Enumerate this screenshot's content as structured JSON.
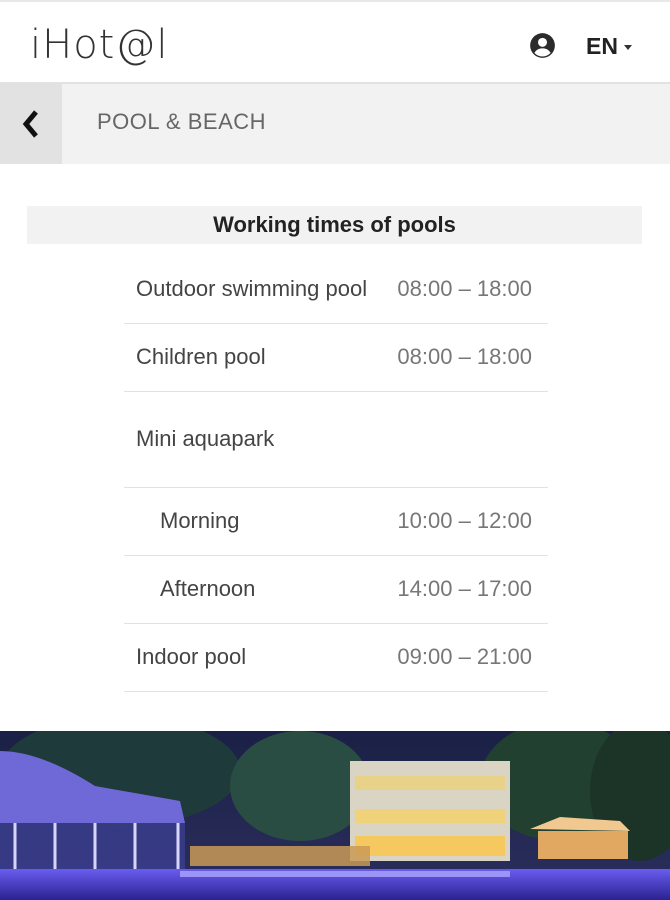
{
  "header": {
    "logo_text": "iHot@l",
    "language": "EN"
  },
  "subbar": {
    "title": "POOL & BEACH"
  },
  "section": {
    "title": "Working times of pools"
  },
  "schedule": [
    {
      "name": "Outdoor swimming pool",
      "time": "08:00 – 18:00"
    },
    {
      "name": "Children pool",
      "time": "08:00 – 18:00"
    },
    {
      "name": "Mini aquapark",
      "time": ""
    },
    {
      "name": "Morning",
      "time": "10:00 – 12:00"
    },
    {
      "name": "Afternoon",
      "time": "14:00 – 17:00"
    },
    {
      "name": "Indoor pool",
      "time": "09:00 – 21:00"
    }
  ],
  "colors": {
    "subbar_bg": "#f2f2f2",
    "back_bg": "#e2e2e2",
    "night_sky": "#1d2247",
    "pool_light": "#5a4bd6"
  },
  "icons": {
    "user": "user-circle-icon",
    "back": "chevron-left-icon",
    "lang_caret": "caret-down-icon"
  }
}
